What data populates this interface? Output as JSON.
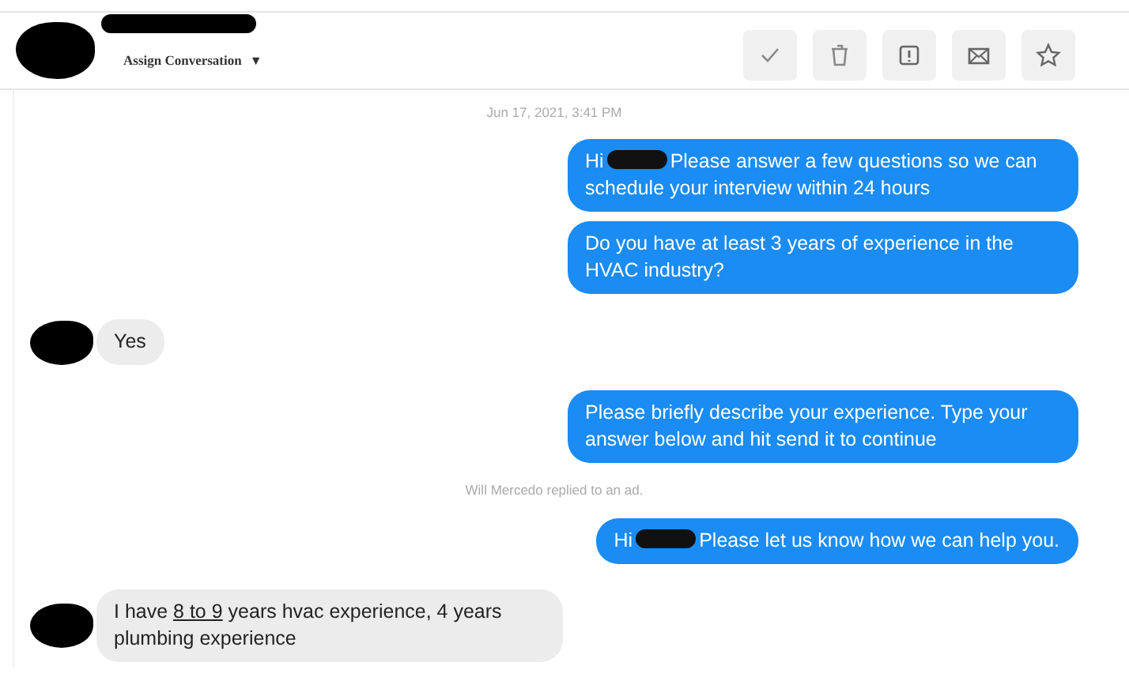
{
  "header": {
    "assign_label": "Assign Conversation",
    "caret": "▼",
    "actions": [
      {
        "kind": "check"
      },
      {
        "kind": "trash"
      },
      {
        "kind": "alert"
      },
      {
        "kind": "mail"
      },
      {
        "kind": "star"
      }
    ]
  },
  "messages": [
    {
      "kind": "timestamp",
      "text": "Jun 17, 2021, 3:41 PM"
    },
    {
      "kind": "sent",
      "parts": [
        {
          "text": "Hi"
        },
        {
          "kind": "redaction"
        },
        {
          "text": "Please answer a few questions so we can schedule your interview within 24 hours"
        }
      ]
    },
    {
      "kind": "sent",
      "parts": [
        {
          "text": "Do you have at least 3 years of experience in the HVAC industry?"
        }
      ]
    },
    {
      "kind": "received",
      "parts": [
        {
          "text": "Yes"
        }
      ]
    },
    {
      "kind": "sent",
      "parts": [
        {
          "text": "Please briefly describe your experience. Type your answer below and hit send it to continue"
        }
      ]
    },
    {
      "kind": "notice",
      "text": "Will Mercedo replied to an ad."
    },
    {
      "kind": "sent",
      "parts": [
        {
          "text": "Hi"
        },
        {
          "kind": "redaction"
        },
        {
          "text": "Please let us know how we can help you."
        }
      ]
    },
    {
      "kind": "received",
      "parts": [
        {
          "text": "I have "
        },
        {
          "text": "8 to 9",
          "underline": true
        },
        {
          "text": " years hvac experience, 4 years plumbing experience"
        }
      ]
    }
  ]
}
